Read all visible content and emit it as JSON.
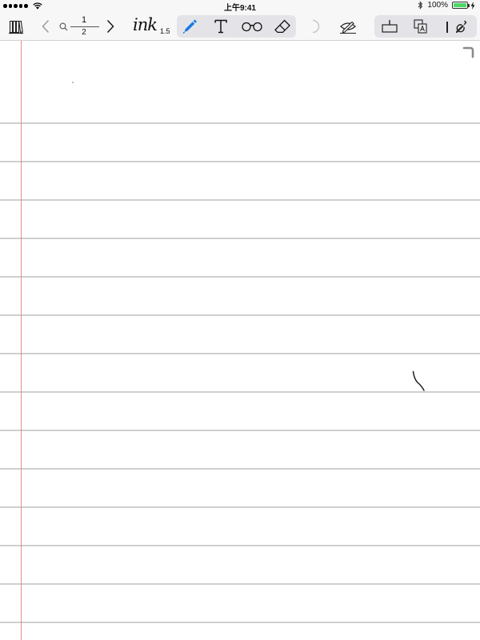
{
  "status_bar": {
    "time": "上午9:41",
    "battery_text": "100%",
    "battery_level": 1.0,
    "icons": [
      "signal-dots",
      "wifi-icon",
      "bluetooth-icon",
      "battery-icon",
      "charging-bolt-icon"
    ]
  },
  "toolbar": {
    "page_current": "1",
    "page_total": "2",
    "ink_label": "ink",
    "ink_size": "1.5",
    "active_tool": "pen",
    "icons": [
      "library-icon",
      "back-chevron-icon",
      "search-icon",
      "forward-chevron-icon",
      "pen-icon",
      "text-tool-icon",
      "glasses-icon",
      "eraser-icon",
      "undo-icon",
      "hide-pen-icon",
      "page-insert-icon",
      "page-template-icon",
      "settings-wrench-icon"
    ]
  },
  "colors": {
    "accent": "#1a7ae0",
    "bar_background": "#f7f7f7",
    "margin_line": "#e88a8a",
    "rule_line": "#cfcfcf",
    "battery_green": "#4cd964"
  },
  "page": {
    "style": "ruled notebook with red margin line",
    "ruled_lines": 13
  }
}
